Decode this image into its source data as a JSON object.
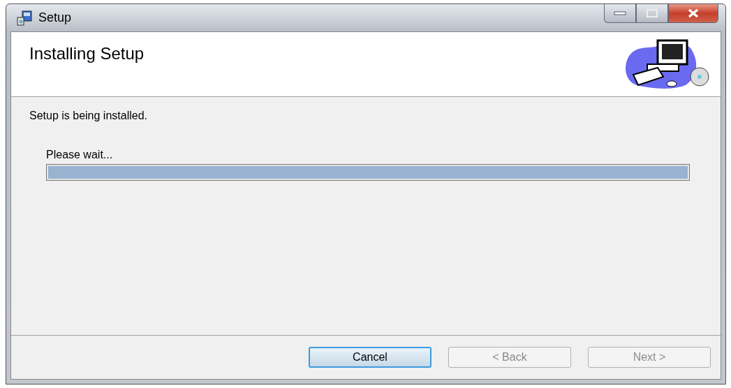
{
  "window": {
    "title": "Setup"
  },
  "header": {
    "title": "Installing Setup"
  },
  "body": {
    "message": "Setup is being installed.",
    "progress_label": "Please wait...",
    "progress": {
      "level": 1
    }
  },
  "buttons": [
    {
      "label": "Cancel",
      "disabled": false,
      "focused": true
    },
    {
      "label": "< Back",
      "disabled": true,
      "focused": false
    },
    {
      "label": "Next >",
      "disabled": true,
      "focused": false
    }
  ]
}
